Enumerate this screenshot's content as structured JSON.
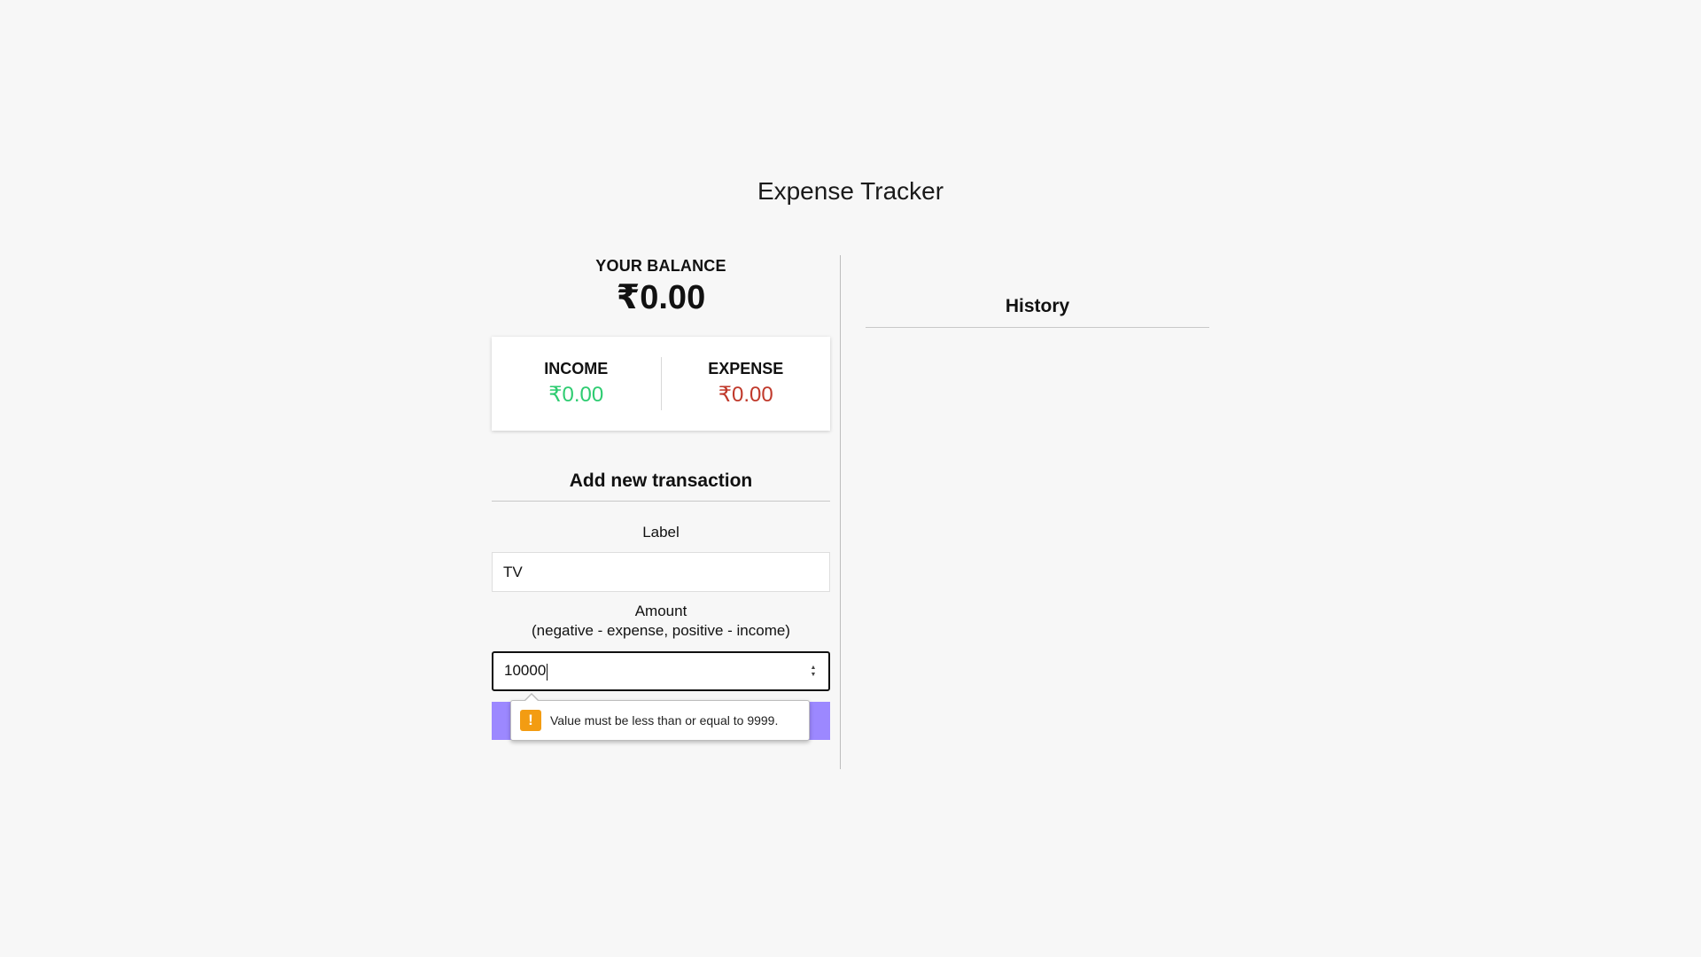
{
  "app": {
    "title": "Expense Tracker"
  },
  "balance": {
    "label": "YOUR BALANCE",
    "value": "₹0.00"
  },
  "summary": {
    "income_label": "INCOME",
    "income_value": "₹0.00",
    "expense_label": "EXPENSE",
    "expense_value": "₹0.00"
  },
  "form": {
    "title": "Add new transaction",
    "label_field_label": "Label",
    "label_field_value": "TV",
    "amount_field_label": "Amount",
    "amount_field_hint": "(negative - expense, positive - income)",
    "amount_field_value": "10000",
    "validation_message": "Value must be less than or equal to 9999."
  },
  "history": {
    "title": "History"
  },
  "colors": {
    "income": "#2ecc71",
    "expense": "#c0392b",
    "button": "#9c88ff",
    "warning": "#f39c12"
  },
  "icons": {
    "warning": "warning-icon",
    "spinner_up": "spinner-up-icon",
    "spinner_down": "spinner-down-icon"
  }
}
